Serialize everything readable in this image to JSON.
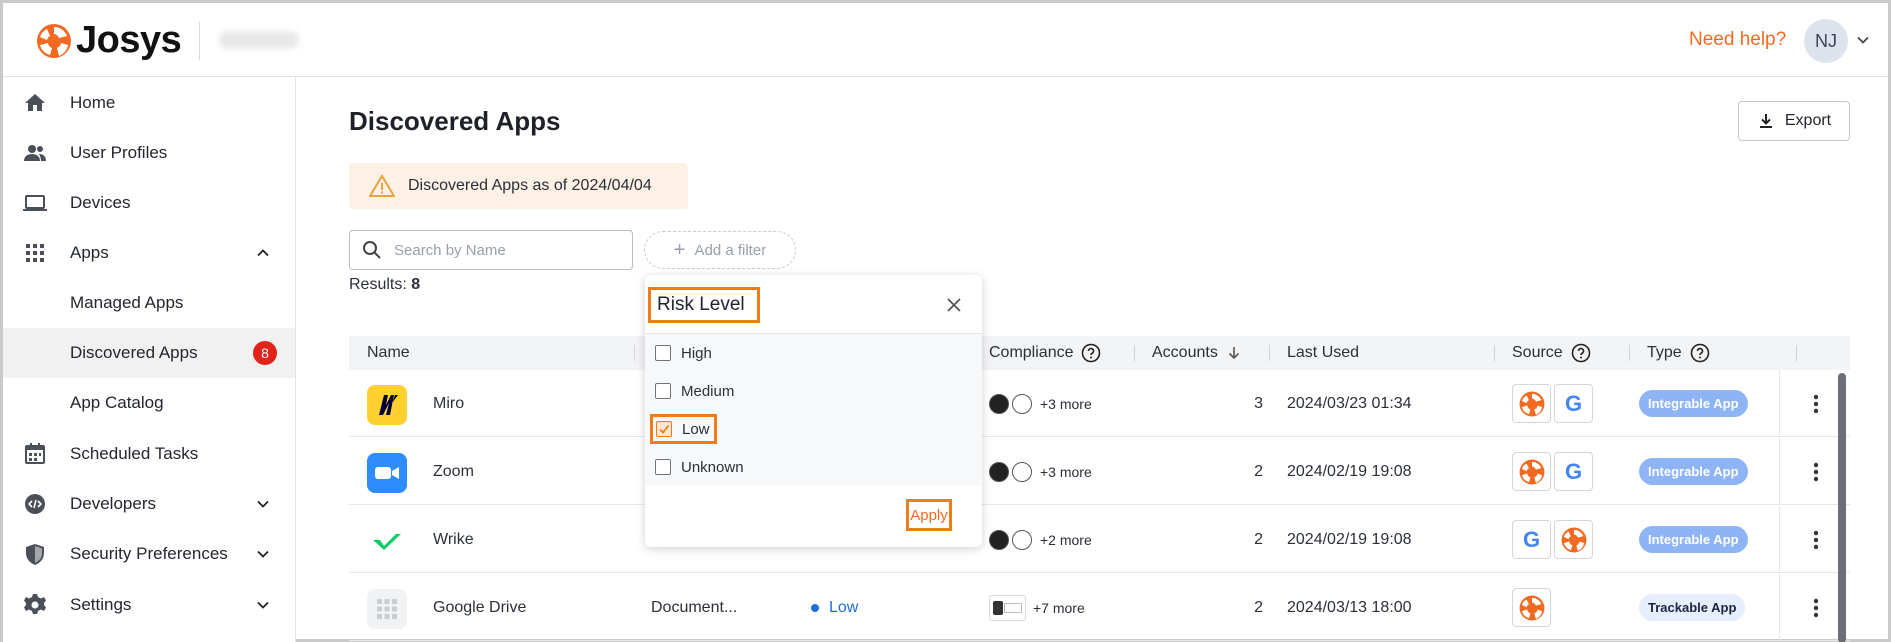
{
  "brand": {
    "name": "Josys",
    "accent": "#f26a21"
  },
  "header": {
    "help_label": "Need help?",
    "avatar_initials": "NJ"
  },
  "sidebar": {
    "items": [
      {
        "label": "Home",
        "icon": "home-icon"
      },
      {
        "label": "User Profiles",
        "icon": "users-icon"
      },
      {
        "label": "Devices",
        "icon": "laptop-icon"
      },
      {
        "label": "Apps",
        "icon": "grid-icon",
        "expanded": true
      },
      {
        "label": "Managed Apps"
      },
      {
        "label": "Discovered Apps",
        "badge": "8",
        "active": true
      },
      {
        "label": "App Catalog"
      },
      {
        "label": "Scheduled Tasks",
        "icon": "calendar-icon"
      },
      {
        "label": "Developers",
        "icon": "code-gear-icon"
      },
      {
        "label": "Security Preferences",
        "icon": "shield-icon"
      },
      {
        "label": "Settings",
        "icon": "gear-icon"
      }
    ]
  },
  "main": {
    "title": "Discovered Apps",
    "export_label": "Export",
    "notice": "Discovered Apps as of 2024/04/04",
    "search_placeholder": "Search by Name",
    "add_filter_label": "Add a filter",
    "results_label": "Results:",
    "results_count": "8"
  },
  "table": {
    "columns": [
      "Name",
      "Compliance",
      "Accounts",
      "Last Used",
      "Source",
      "Type"
    ],
    "rows": [
      {
        "name": "Miro",
        "compliance_more": "+3 more",
        "accounts": "3",
        "last_used": "2024/03/23 01:34",
        "type": "Integrable App"
      },
      {
        "name": "Zoom",
        "compliance_more": "+3 more",
        "accounts": "2",
        "last_used": "2024/02/19 19:08",
        "type": "Integrable App"
      },
      {
        "name": "Wrike",
        "compliance_more": "+2 more",
        "accounts": "2",
        "last_used": "2024/02/19 19:08",
        "type": "Integrable App"
      },
      {
        "name": "Google Drive",
        "category": "Document...",
        "risk": "Low",
        "compliance_more": "+7 more",
        "accounts": "2",
        "last_used": "2024/03/13 18:00",
        "type": "Trackable App"
      }
    ]
  },
  "filter_popover": {
    "title": "Risk Level",
    "options": [
      {
        "label": "High",
        "checked": false
      },
      {
        "label": "Medium",
        "checked": false
      },
      {
        "label": "Low",
        "checked": true
      },
      {
        "label": "Unknown",
        "checked": false
      }
    ],
    "apply_label": "Apply"
  }
}
